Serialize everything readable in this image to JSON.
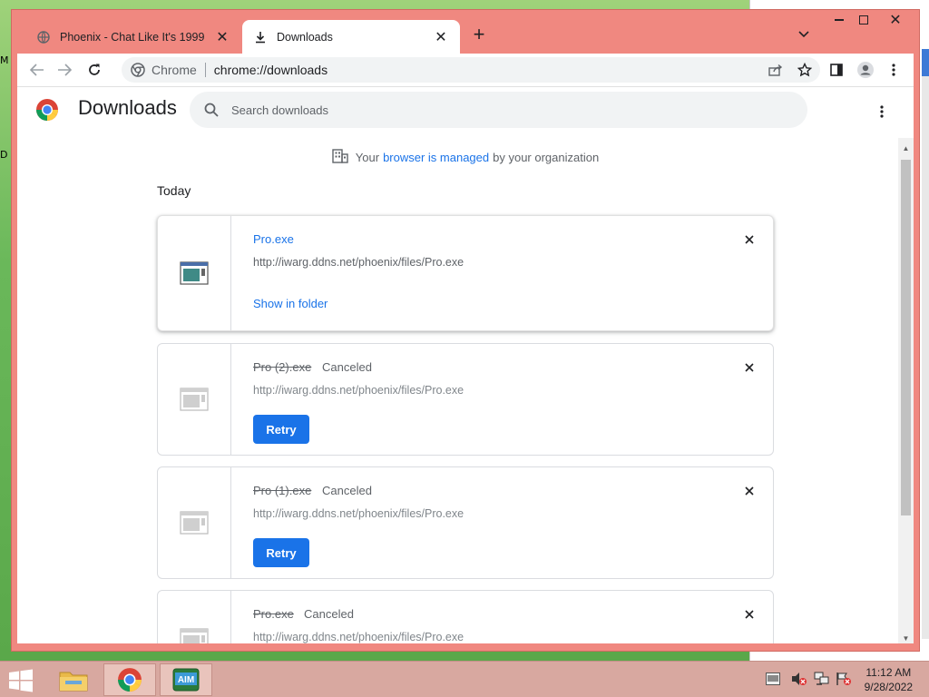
{
  "desktop": {
    "labels": [
      "M",
      "D"
    ]
  },
  "browser": {
    "tabs": [
      {
        "label": "Phoenix - Chat Like It's 1999",
        "active": false
      },
      {
        "label": "Downloads",
        "active": true
      }
    ],
    "omnibox": {
      "site_label": "Chrome",
      "url": "chrome://downloads"
    }
  },
  "page": {
    "title": "Downloads",
    "search_placeholder": "Search downloads",
    "managed": {
      "prefix": "Your",
      "link": "browser is managed",
      "suffix": "by your organization"
    },
    "section": "Today",
    "downloads": [
      {
        "name": "Pro.exe",
        "status": "",
        "url": "http://iwarg.ddns.net/phoenix/files/Pro.exe",
        "action": "Show in folder"
      },
      {
        "name": "Pro (2).exe",
        "status": "Canceled",
        "url": "http://iwarg.ddns.net/phoenix/files/Pro.exe",
        "action": "Retry"
      },
      {
        "name": "Pro (1).exe",
        "status": "Canceled",
        "url": "http://iwarg.ddns.net/phoenix/files/Pro.exe",
        "action": "Retry"
      },
      {
        "name": "Pro.exe",
        "status": "Canceled",
        "url": "http://iwarg.ddns.net/phoenix/files/Pro.exe",
        "action": ""
      }
    ]
  },
  "taskbar": {
    "time": "11:12 AM",
    "date": "9/28/2022",
    "apps": [
      "file-explorer",
      "chrome",
      "aim"
    ]
  },
  "colors": {
    "accent": "#1a73e8",
    "frame": "#f08880",
    "taskbar": "#d8a8a0"
  }
}
